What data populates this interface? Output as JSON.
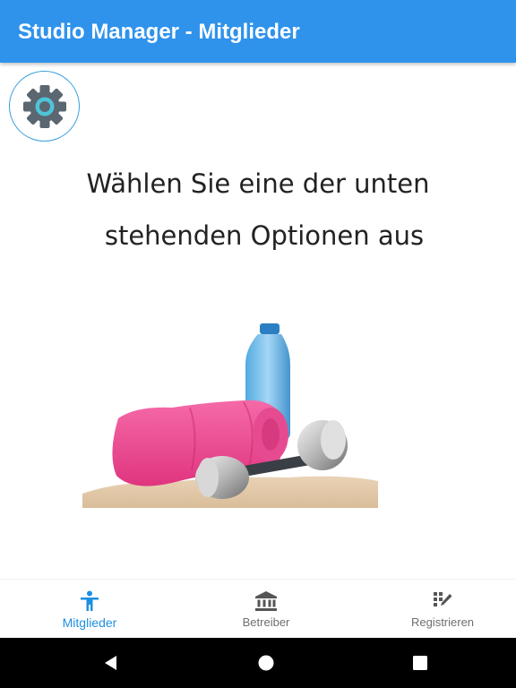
{
  "app": {
    "title": "Studio Manager - Mitglieder"
  },
  "colors": {
    "appbar": "#2f93ec",
    "accent": "#1e8fe0",
    "inactive": "#6f6f6f"
  },
  "settings": {
    "icon": "gear-icon"
  },
  "main": {
    "prompt_line1": "Wählen Sie eine der unten",
    "prompt_line2": "stehenden Optionen aus",
    "image": "towel-dumbbells-water-bottle-image"
  },
  "bottom_nav": {
    "items": [
      {
        "label": "Mitglieder",
        "icon": "person-icon",
        "active": true
      },
      {
        "label": "Betreiber",
        "icon": "bank-icon",
        "active": false
      },
      {
        "label": "Registrieren",
        "icon": "register-edit-icon",
        "active": false
      }
    ]
  },
  "system_nav": {
    "buttons": [
      "back-icon",
      "home-icon",
      "recents-icon"
    ]
  }
}
